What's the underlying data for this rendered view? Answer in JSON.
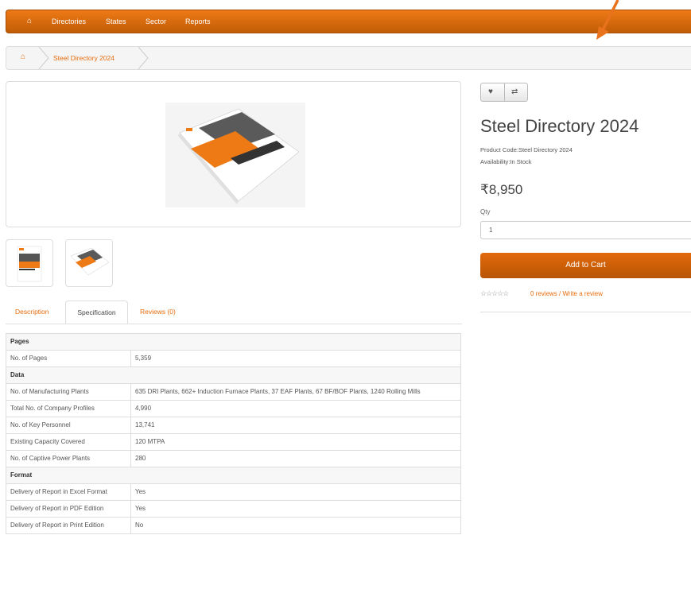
{
  "nav": {
    "home_icon": "home-icon",
    "items": [
      "Directories",
      "States",
      "Sector",
      "Reports"
    ]
  },
  "breadcrumb": {
    "home_icon": "home-icon",
    "current": "Steel Directory 2024"
  },
  "product": {
    "title": "Steel Directory 2024",
    "code_label": "Product Code:",
    "code": "Steel Directory 2024",
    "availability_label": "Availability:",
    "availability": "In Stock",
    "price": "₹8,950",
    "qty_label": "Qty",
    "qty_value": "1",
    "add_to_cart": "Add to Cart",
    "reviews_link": "0 reviews",
    "review_sep": " / ",
    "write_review": "Write a review",
    "wishlist_icon": "heart-icon",
    "compare_icon": "compare-arrows-icon"
  },
  "tabs": [
    "Description",
    "Specification",
    "Reviews (0)"
  ],
  "spec": {
    "groups": [
      {
        "title": "Pages",
        "rows": [
          [
            "No. of Pages",
            "5,359"
          ]
        ]
      },
      {
        "title": "Data",
        "rows": [
          [
            "No. of Manufacturing Plants",
            "635 DRI Plants, 662+ Induction Furnace Plants, 37 EAF Plants, 67 BF/BOF Plants, 1240 Rolling Mills"
          ],
          [
            "Total No. of Company Profiles",
            "4,990"
          ],
          [
            "No. of Key Personnel",
            "13,741"
          ],
          [
            "Existing Capacity Covered",
            "120 MTPA"
          ],
          [
            "No. of Captive Power Plants",
            "280"
          ]
        ]
      },
      {
        "title": "Format",
        "rows": [
          [
            "Delivery of Report in Excel Format",
            "Yes"
          ],
          [
            "Delivery of Report in PDF Edition",
            "Yes"
          ],
          [
            "Delivery of Report in Print Edition",
            "No"
          ]
        ]
      }
    ]
  },
  "colors": {
    "accent": "#e76c0c",
    "nav": "#d96a0e"
  }
}
